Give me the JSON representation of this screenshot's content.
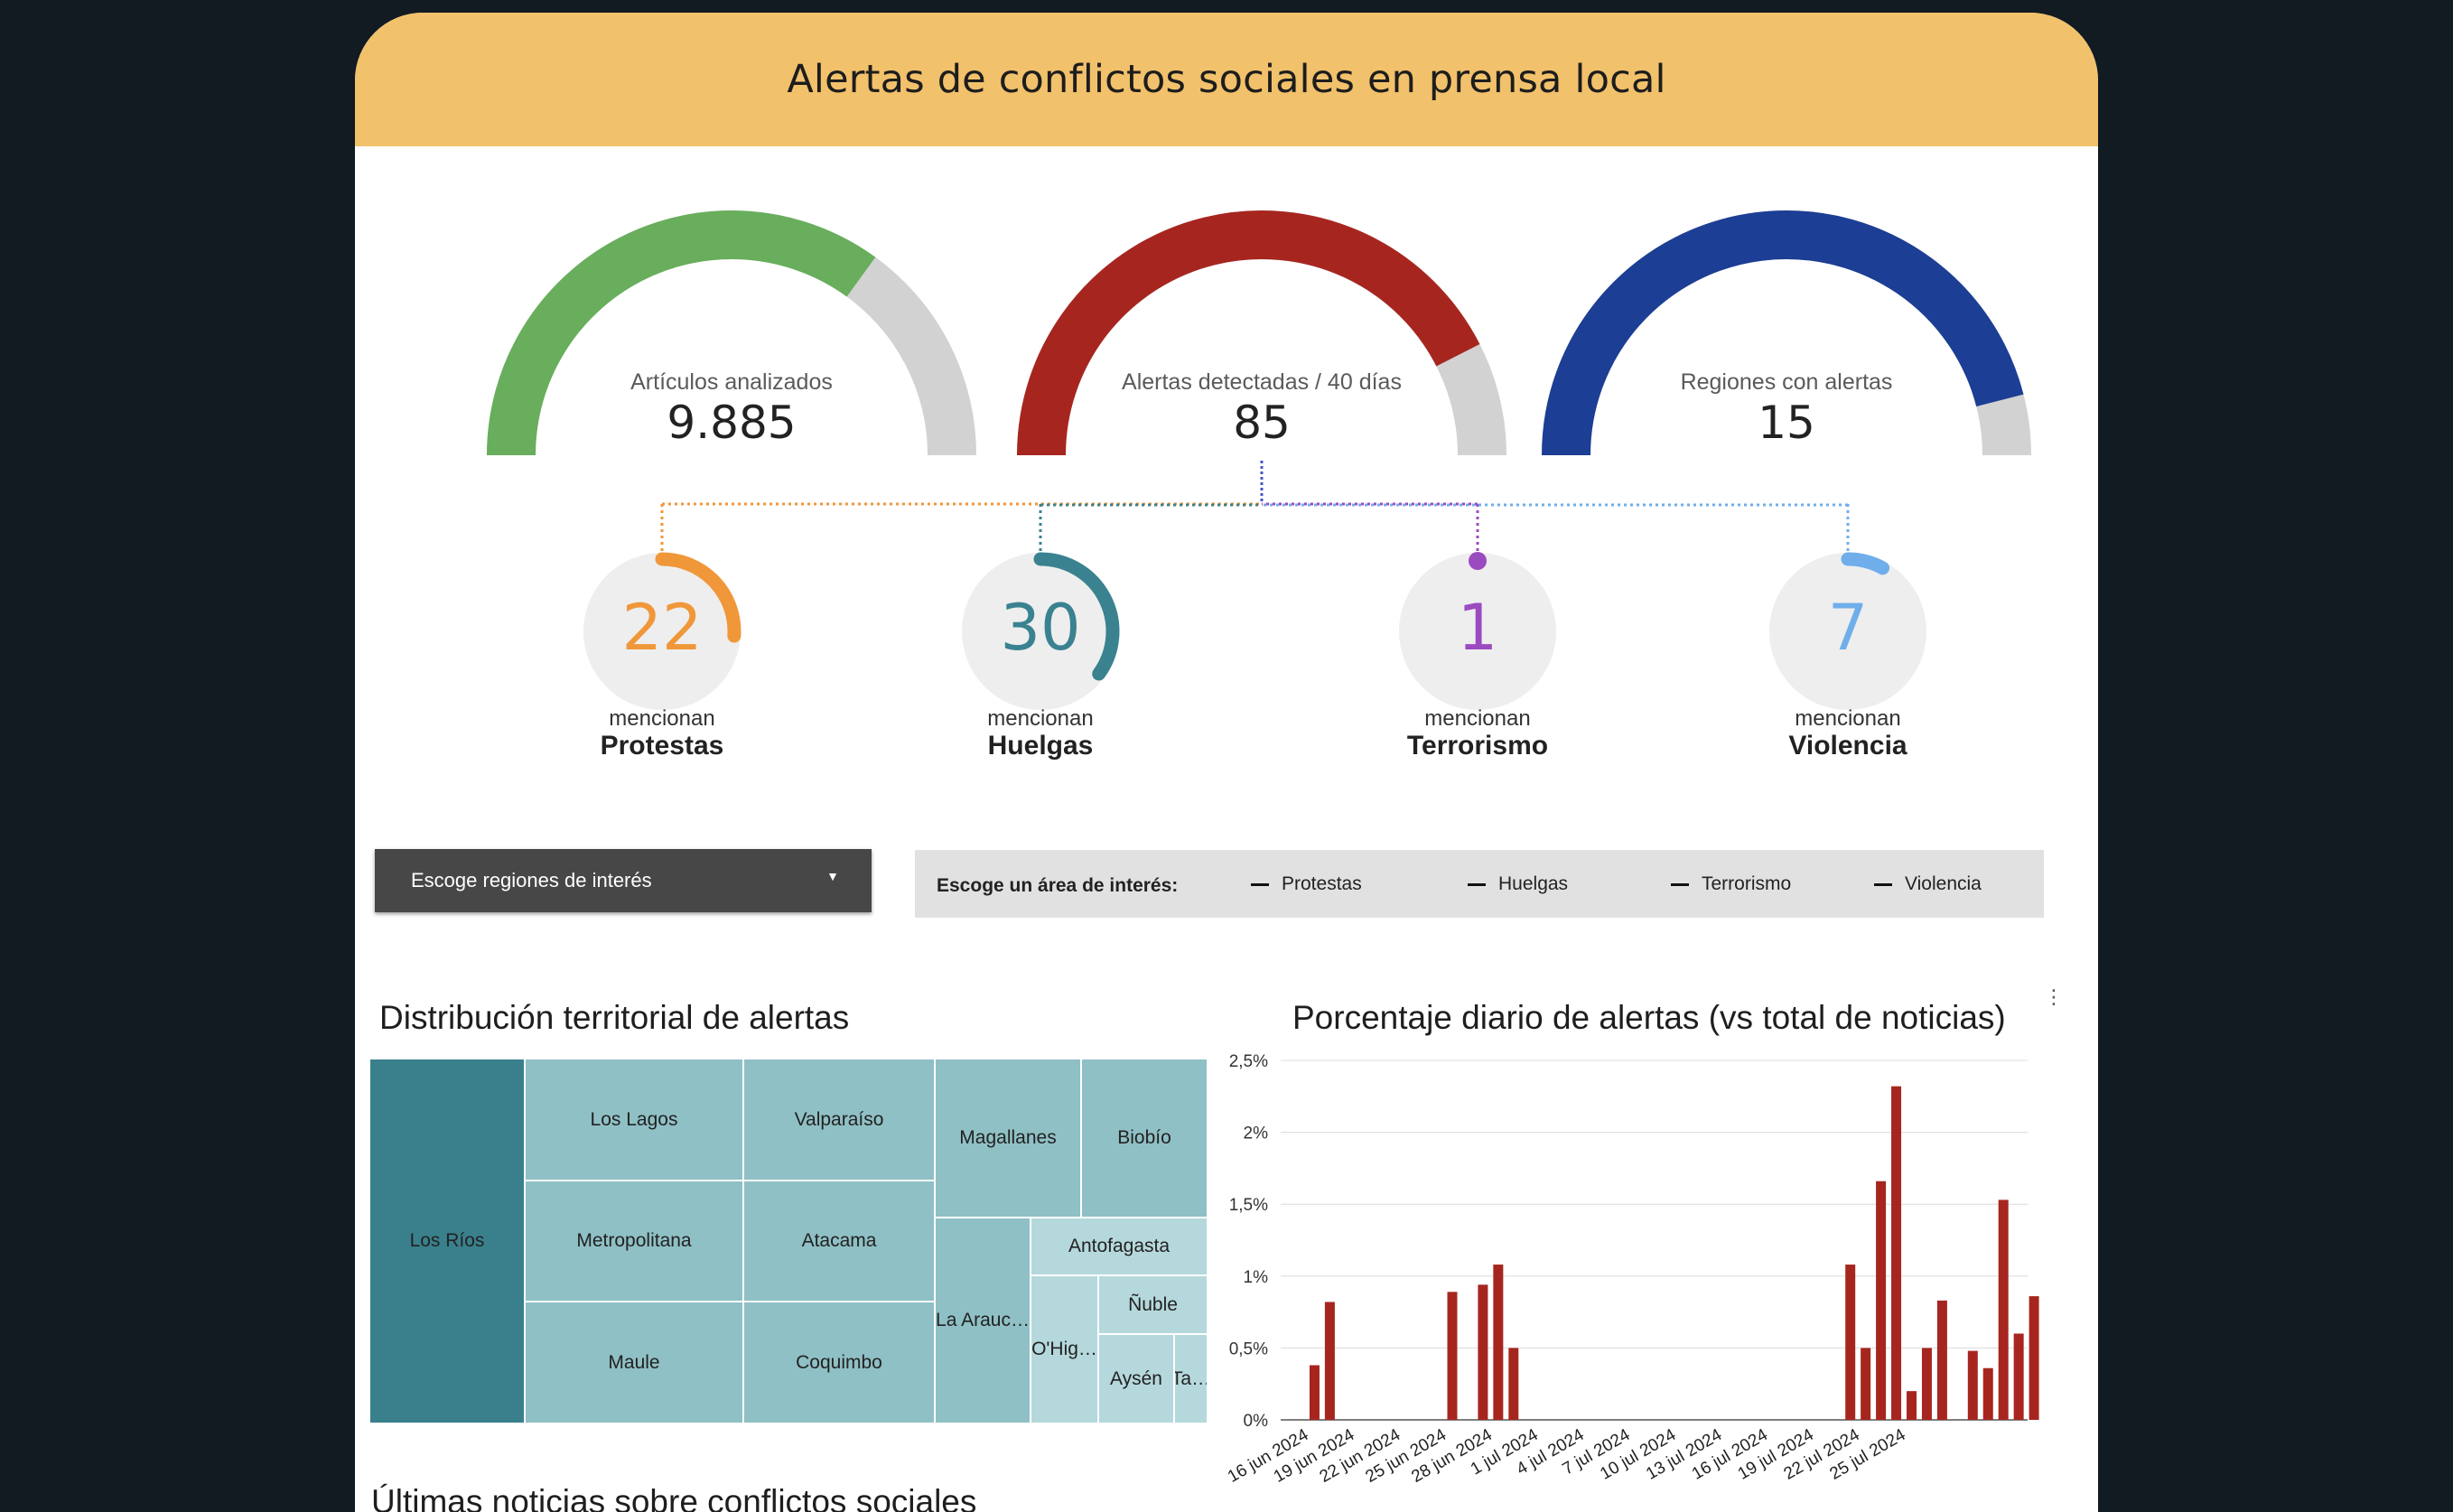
{
  "header": {
    "title": "Alertas de conflictos sociales en prensa local"
  },
  "gauges": [
    {
      "label": "Artículos analizados",
      "value": "9.885",
      "fill": 0.7,
      "color": "#68ae5c"
    },
    {
      "label": "Alertas detectadas / 40 días",
      "value": "85",
      "fill": 0.85,
      "color": "#a6261f"
    },
    {
      "label": "Regiones con alertas",
      "value": "15",
      "fill": 0.92,
      "color": "#1c3e94"
    }
  ],
  "keywords": [
    {
      "value": "22",
      "prefix": "mencionan",
      "name": "Protestas",
      "color": "#f0973a",
      "fill": 0.26
    },
    {
      "value": "30",
      "prefix": "mencionan",
      "name": "Huelgas",
      "color": "#3a8290",
      "fill": 0.35
    },
    {
      "value": "1",
      "prefix": "mencionan",
      "name": "Terrorismo",
      "color": "#9b4bc0",
      "fill": 0.012
    },
    {
      "value": "7",
      "prefix": "mencionan",
      "name": "Violencia",
      "color": "#6faeea",
      "fill": 0.08
    }
  ],
  "filters": {
    "region_dropdown": "Escoge regiones de interés",
    "area_prompt": "Escoge un área de interés:",
    "area_options": [
      "Protestas",
      "Huelgas",
      "Terrorismo",
      "Violencia"
    ]
  },
  "treemap": {
    "title": "Distribución territorial de alertas",
    "colors": {
      "dark": "#39808c",
      "mid": "#8fc0c5",
      "light": "#b5d8dc"
    },
    "cells": [
      "Los Ríos",
      "Los Lagos",
      "Valparaíso",
      "Magallanes",
      "Biobío",
      "Metropolitana",
      "Atacama",
      "Antofagasta",
      "Maule",
      "Coquimbo",
      "La Arauc…",
      "Ñuble",
      "O'Hig…",
      "Aysén",
      "Ta…"
    ]
  },
  "chart_data": {
    "type": "bar",
    "title": "Porcentaje diario de alertas (vs total de noticias)",
    "color": "#a6261f",
    "ylim": [
      0,
      2.5
    ],
    "yticks": [
      "0%",
      "0,5%",
      "1%",
      "1,5%",
      "2%",
      "2,5%"
    ],
    "x_labels": [
      "16 jun 2024",
      "19 jun 2024",
      "22 jun 2024",
      "25 jun 2024",
      "28 jun 2024",
      "1 jul 2024",
      "4 jul 2024",
      "7 jul 2024",
      "10 jul 2024",
      "13 jul 2024",
      "16 jul 2024",
      "19 jul 2024",
      "22 jul 2024",
      "25 jul 2024"
    ],
    "values": [
      0,
      0.38,
      0.82,
      0,
      0,
      0,
      0,
      0,
      0,
      0,
      0.89,
      0,
      0.94,
      1.08,
      0.5,
      0,
      0,
      0,
      0,
      0,
      0,
      0,
      0,
      0,
      0,
      0,
      0,
      0,
      0,
      0,
      0,
      0,
      0,
      0,
      0,
      0,
      1.08,
      0.5,
      1.66,
      2.32,
      0.2,
      0.5,
      0.83,
      0,
      0.48,
      0.36,
      1.53,
      0.6,
      0.86
    ],
    "grid": true,
    "legend": "none"
  },
  "news": {
    "title": "Últimas noticias sobre conflictos sociales"
  }
}
